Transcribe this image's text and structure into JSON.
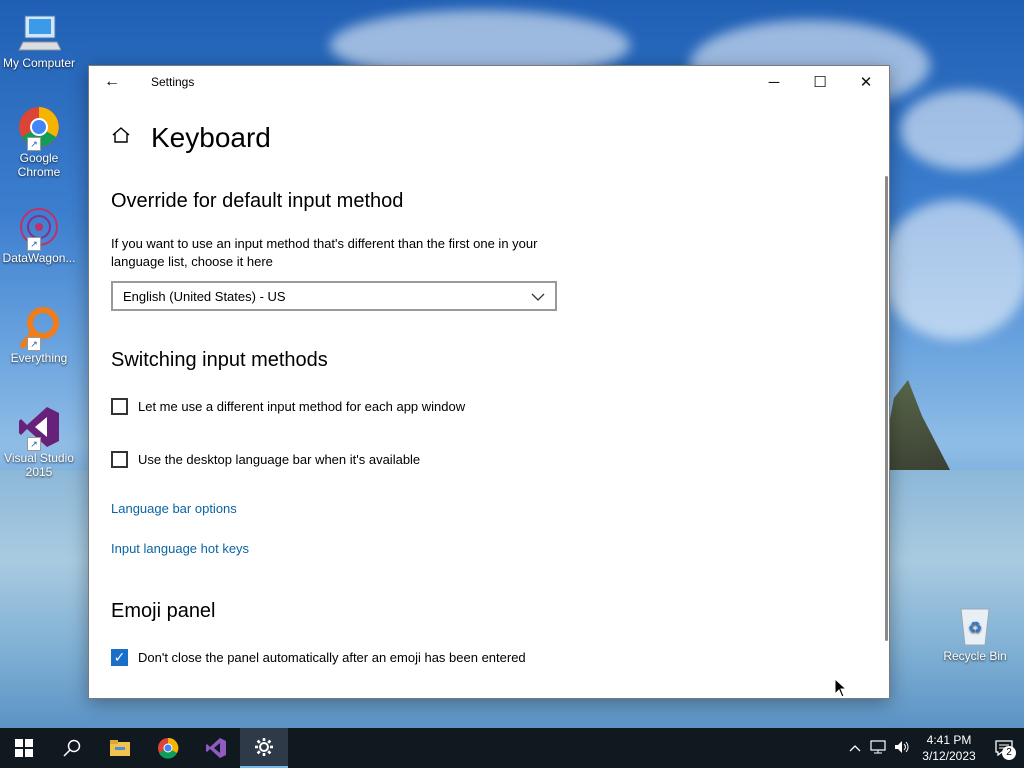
{
  "desktop": {
    "icons": [
      {
        "label": "My Computer"
      },
      {
        "label": "Google Chrome"
      },
      {
        "label": "DataWagon..."
      },
      {
        "label": "Everything"
      },
      {
        "label": "Visual Studio 2015"
      },
      {
        "label": "Recycle Bin"
      }
    ]
  },
  "window": {
    "title": "Settings",
    "back_icon": "back-arrow-icon",
    "controls": {
      "minimize": "─",
      "maximize": "☐",
      "close": "✕"
    }
  },
  "page": {
    "title": "Keyboard",
    "home_icon": "home-icon",
    "override": {
      "heading": "Override for default input method",
      "description": "If you want to use an input method that's different than the first one in your language list, choose it here",
      "selected": "English (United States) - US"
    },
    "switching": {
      "heading": "Switching input methods",
      "option1": {
        "label": "Let me use a different input method for each app window",
        "checked": false
      },
      "option2": {
        "label": "Use the desktop language bar when it's available",
        "checked": false
      },
      "link1": "Language bar options",
      "link2": "Input language hot keys"
    },
    "emoji": {
      "heading": "Emoji panel",
      "option": {
        "label": "Don't close the panel automatically after an emoji has been entered",
        "checked": true
      }
    }
  },
  "taskbar": {
    "time": "4:41 PM",
    "date": "3/12/2023",
    "notification_count": "2"
  },
  "colors": {
    "accent": "#1a6fc9",
    "link": "#0a64a4",
    "taskbar": "#101820"
  }
}
